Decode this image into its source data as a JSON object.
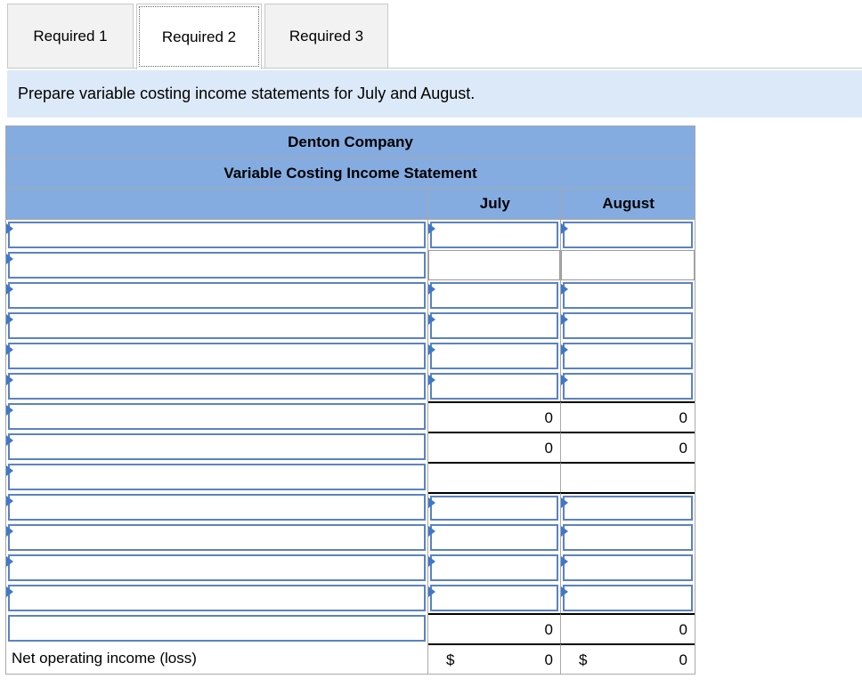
{
  "tabs": [
    {
      "label": "Required 1",
      "active": false
    },
    {
      "label": "Required 2",
      "active": true
    },
    {
      "label": "Required 3",
      "active": false
    }
  ],
  "instruction": "Prepare variable costing income statements for July and August.",
  "statement": {
    "company": "Denton Company",
    "title": "Variable Costing Income Statement",
    "columns": [
      "July",
      "August"
    ],
    "rows": [
      {
        "label": "",
        "july": "",
        "august": ""
      },
      {
        "label": "",
        "july": "",
        "august": ""
      },
      {
        "label": "",
        "july": "",
        "august": ""
      },
      {
        "label": "",
        "july": "",
        "august": ""
      },
      {
        "label": "",
        "july": "",
        "august": ""
      },
      {
        "label": "",
        "july": "",
        "august": ""
      },
      {
        "label": "",
        "july": "0",
        "august": "0"
      },
      {
        "label": "",
        "july": "0",
        "august": "0"
      },
      {
        "label": "",
        "july": "",
        "august": ""
      },
      {
        "label": "",
        "july": "",
        "august": ""
      },
      {
        "label": "",
        "july": "",
        "august": ""
      },
      {
        "label": "",
        "july": "",
        "august": ""
      },
      {
        "label": "",
        "july": "",
        "august": ""
      },
      {
        "label": "",
        "july": "0",
        "august": "0"
      },
      {
        "label": "Net operating income (loss)",
        "july_currency": "$",
        "july": "0",
        "august_currency": "$",
        "august": "0"
      }
    ]
  }
}
